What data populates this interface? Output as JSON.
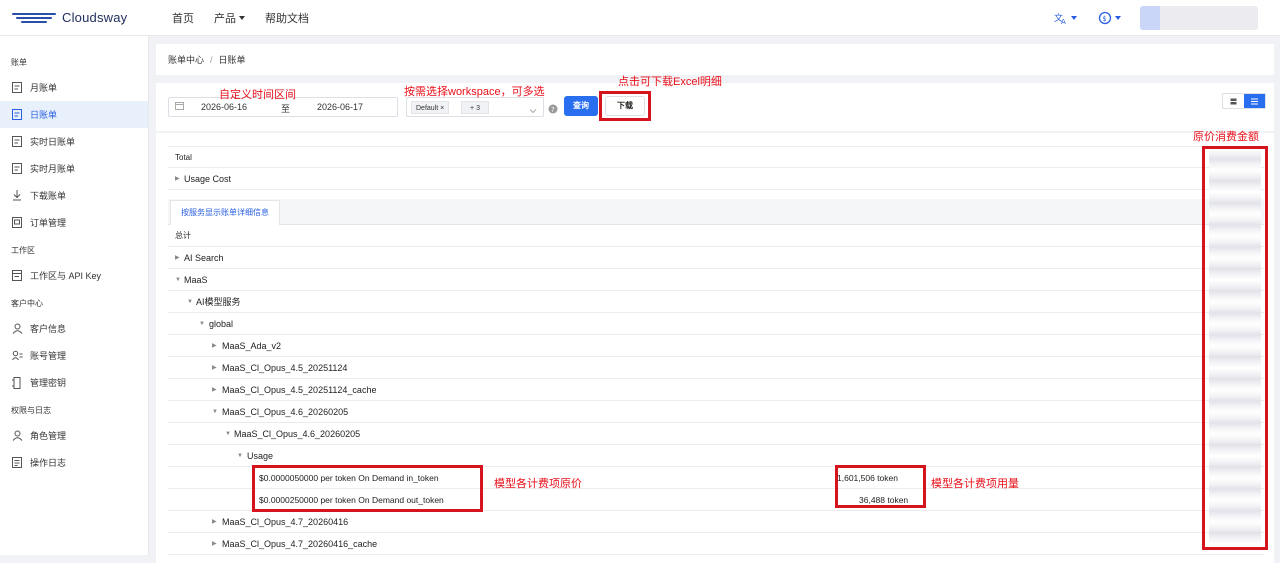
{
  "brand": "Cloudsway",
  "nav": {
    "home": "首页",
    "products": "产品",
    "docs": "帮助文档"
  },
  "icons": {
    "translate": "translate-icon",
    "currency": "currency-exchange-icon"
  },
  "sidebar": {
    "groups": [
      {
        "title": "账单",
        "items": [
          {
            "label": "月账单",
            "icon": "document-icon",
            "active": false
          },
          {
            "label": "日账单",
            "icon": "document-icon",
            "active": true
          },
          {
            "label": "实时日账单",
            "icon": "document-icon",
            "active": false
          },
          {
            "label": "实时月账单",
            "icon": "document-icon",
            "active": false
          },
          {
            "label": "下载账单",
            "icon": "download-icon",
            "active": false
          },
          {
            "label": "订单管理",
            "icon": "order-icon",
            "active": false
          }
        ]
      },
      {
        "title": "工作区",
        "items": [
          {
            "label": "工作区与 API Key",
            "icon": "workspace-icon",
            "active": false
          }
        ]
      },
      {
        "title": "客户中心",
        "items": [
          {
            "label": "客户信息",
            "icon": "user-icon",
            "active": false
          },
          {
            "label": "账号管理",
            "icon": "account-icon",
            "active": false
          },
          {
            "label": "管理密钥",
            "icon": "key-icon",
            "active": false
          }
        ]
      },
      {
        "title": "权限与日志",
        "items": [
          {
            "label": "角色管理",
            "icon": "role-icon",
            "active": false
          },
          {
            "label": "操作日志",
            "icon": "log-icon",
            "active": false
          }
        ]
      }
    ]
  },
  "breadcrumb": {
    "parent": "账单中心",
    "separator": "/",
    "current": "日账单"
  },
  "filter": {
    "start_date": "2026-06-16",
    "to": "至",
    "end_date": "2026-06-17",
    "workspace_tag": "Default",
    "workspace_more": "+ 3",
    "query_button": "查询",
    "download_button": "下载"
  },
  "table": {
    "total_label": "Total",
    "usage_cost_label": "Usage Cost",
    "tab_label": "按服务显示账单详细信息",
    "summary_label": "总计",
    "rows": [
      {
        "label": "AI Search",
        "level": 0,
        "expanded": false
      },
      {
        "label": "MaaS",
        "level": 0,
        "expanded": true
      },
      {
        "label": "AI模型服务",
        "level": 1,
        "expanded": true
      },
      {
        "label": "global",
        "level": 2,
        "expanded": true
      },
      {
        "label": "MaaS_Ada_v2",
        "level": 3,
        "expanded": false
      },
      {
        "label": "MaaS_Cl_Opus_4.5_20251124",
        "level": 3,
        "expanded": false
      },
      {
        "label": "MaaS_Cl_Opus_4.5_20251124_cache",
        "level": 3,
        "expanded": false
      },
      {
        "label": "MaaS_Cl_Opus_4.6_20260205",
        "level": 3,
        "expanded": true
      },
      {
        "label": "MaaS_Cl_Opus_4.6_20260205",
        "level": 4,
        "expanded": true
      },
      {
        "label": "Usage",
        "level": 5,
        "expanded": true
      },
      {
        "label": "$0.0000050000 per token On Demand in_token",
        "level": 6,
        "quantity": "1,601,506 token"
      },
      {
        "label": "$0.0000250000 per token On Demand out_token",
        "level": 6,
        "quantity": "36,488 token"
      },
      {
        "label": "MaaS_Cl_Opus_4.7_20260416",
        "level": 3,
        "expanded": false
      },
      {
        "label": "MaaS_Cl_Opus_4.7_20260416_cache",
        "level": 3,
        "expanded": false
      }
    ]
  },
  "annotations": {
    "time_range": "自定义时间区间",
    "workspace": "按需选择workspace，可多选",
    "download": "点击可下载Excel明细",
    "original_amount": "原价消费金额",
    "unit_price": "模型各计费项原价",
    "usage_qty": "模型各计费项用量"
  },
  "colors": {
    "accent": "#2a6ef0",
    "annotation_red": "#d5141d",
    "sidebar_active_bg": "#e8f0fc"
  }
}
